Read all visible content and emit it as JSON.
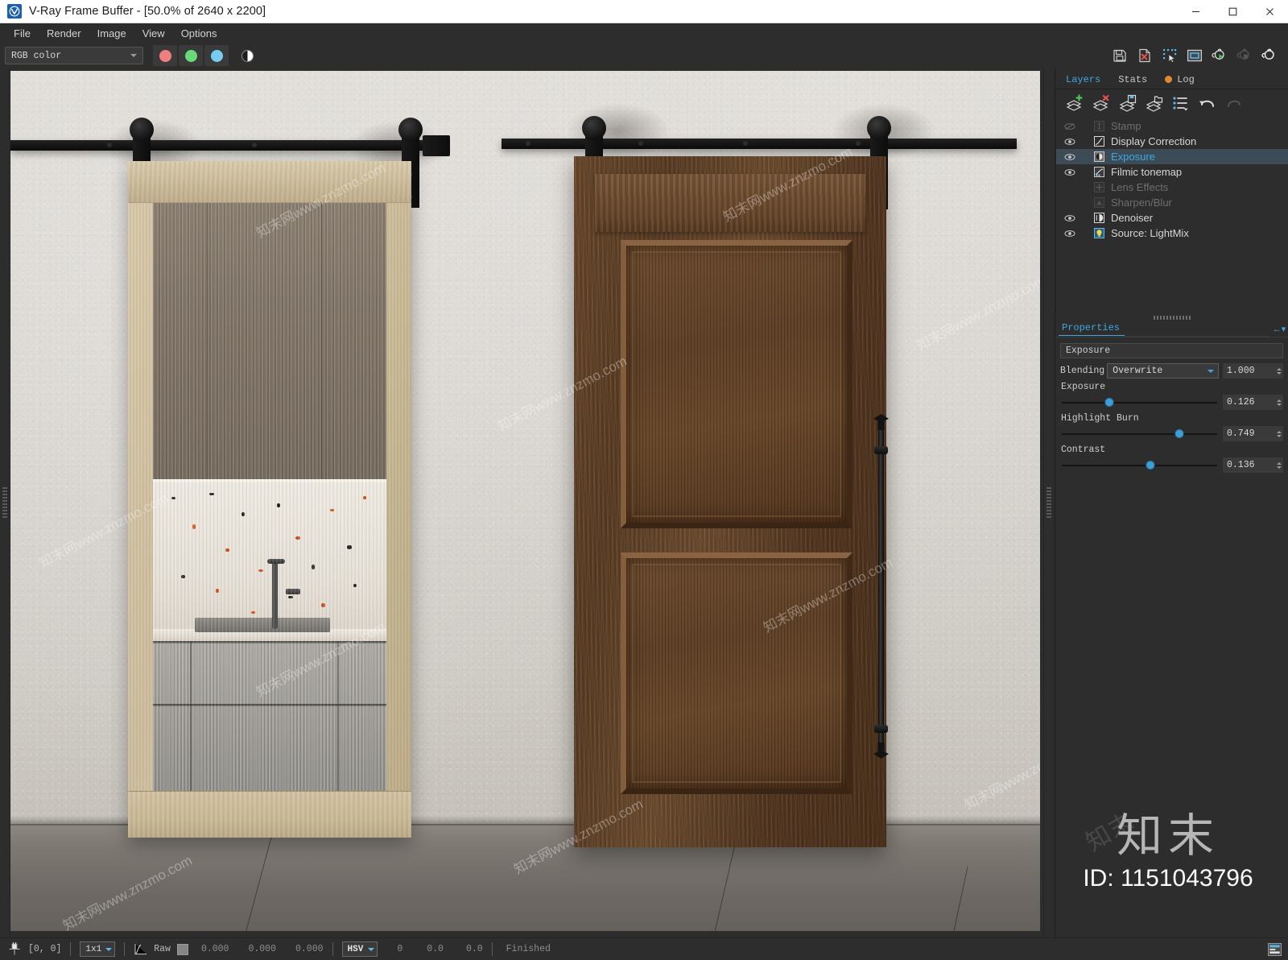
{
  "window": {
    "title": "V-Ray Frame Buffer - [50.0% of 2640 x 2200]",
    "app_icon": "vray-logo-icon",
    "minimize_label": "Minimize",
    "maximize_label": "Maximize",
    "close_label": "Close"
  },
  "menubar": {
    "items": [
      {
        "label": "File"
      },
      {
        "label": "Render"
      },
      {
        "label": "Image"
      },
      {
        "label": "View"
      },
      {
        "label": "Options"
      }
    ]
  },
  "toolbar": {
    "channel_select": {
      "value": "RGB color"
    },
    "channel_buttons": [
      {
        "name": "red-channel",
        "color": "#f08080"
      },
      {
        "name": "green-channel",
        "color": "#6bdb78"
      },
      {
        "name": "blue-channel",
        "color": "#77ccf0"
      }
    ],
    "monochrome_button": {
      "name": "monochrome-toggle"
    },
    "right_tools": [
      {
        "name": "save-image-icon",
        "enabled": true
      },
      {
        "name": "clear-image-icon",
        "enabled": true
      },
      {
        "name": "region-select-icon",
        "enabled": true
      },
      {
        "name": "view-image-icon",
        "enabled": true
      },
      {
        "name": "render-start-icon",
        "enabled": true
      },
      {
        "name": "render-stop-icon",
        "enabled": false
      },
      {
        "name": "render-last-icon",
        "enabled": true
      }
    ]
  },
  "rightpanel": {
    "tabs": [
      {
        "label": "Layers",
        "active": true,
        "dot": false
      },
      {
        "label": "Stats",
        "active": false,
        "dot": false
      },
      {
        "label": "Log",
        "active": false,
        "dot": true,
        "dot_color": "#e08a30"
      }
    ],
    "layer_toolbar": [
      {
        "name": "add-layer-icon",
        "enabled": true
      },
      {
        "name": "delete-layer-icon",
        "enabled": true
      },
      {
        "name": "save-layers-icon",
        "enabled": true
      },
      {
        "name": "load-layers-icon",
        "enabled": true
      },
      {
        "name": "layer-options-icon",
        "enabled": true
      },
      {
        "name": "undo-icon",
        "enabled": true
      },
      {
        "name": "redo-icon",
        "enabled": false
      }
    ],
    "layers": [
      {
        "name": "Stamp",
        "icon": "stamp-icon",
        "visible": false,
        "enabled": false,
        "selected": false
      },
      {
        "name": "Display Correction",
        "icon": "curve-icon",
        "visible": true,
        "enabled": true,
        "selected": false
      },
      {
        "name": "Exposure",
        "icon": "exposure-icon",
        "visible": true,
        "enabled": true,
        "selected": true
      },
      {
        "name": "Filmic tonemap",
        "icon": "filmic-icon",
        "visible": true,
        "enabled": true,
        "selected": false
      },
      {
        "name": "Lens Effects",
        "icon": "lens-effects-icon",
        "visible": false,
        "enabled": false,
        "selected": false
      },
      {
        "name": "Sharpen/Blur",
        "icon": "sharpen-blur-icon",
        "visible": false,
        "enabled": false,
        "selected": false
      },
      {
        "name": "Denoiser",
        "icon": "denoiser-icon",
        "visible": true,
        "enabled": true,
        "selected": false
      },
      {
        "name": "Source: LightMix",
        "icon": "lightmix-icon",
        "visible": true,
        "enabled": true,
        "selected": false
      }
    ],
    "properties": {
      "tab_label": "Properties",
      "layer_name": "Exposure",
      "blending": {
        "label": "Blending",
        "value": "Overwrite",
        "opacity": "1.000"
      },
      "sliders": [
        {
          "label": "Exposure",
          "value": "0.126",
          "percent": 31
        },
        {
          "label": "Highlight Burn",
          "value": "0.749",
          "percent": 75
        },
        {
          "label": "Contrast",
          "value": "0.136",
          "percent": 57
        }
      ]
    }
  },
  "statusbar": {
    "pixel_lock_icon": "pixel-lock-icon",
    "coordinates": "[0, 0]",
    "ratio": "1x1",
    "curve_icon": "gamma-curve-icon",
    "raw_label": "Raw",
    "swatch_color": "#868686",
    "rgb_values": [
      "0.000",
      "0.000",
      "0.000"
    ],
    "color_mode": "HSV",
    "hsv_values": [
      "0",
      "0.0",
      "0.0"
    ],
    "render_status": "Finished",
    "right_icon": "layout-toggle-icon"
  },
  "render": {
    "scene_description": "Two sliding barn doors on a black rail against a textured plaster wall; left door is light oak with fluted glass showing a kitchen with terrazzo backsplash and sink, right door is a dark walnut panelled door with a black wrought-iron handle.",
    "watermarks": {
      "tile_text": "知末网www.znzmo.com",
      "logo_cn": "知末",
      "id_label": "ID: 1151043796"
    }
  }
}
